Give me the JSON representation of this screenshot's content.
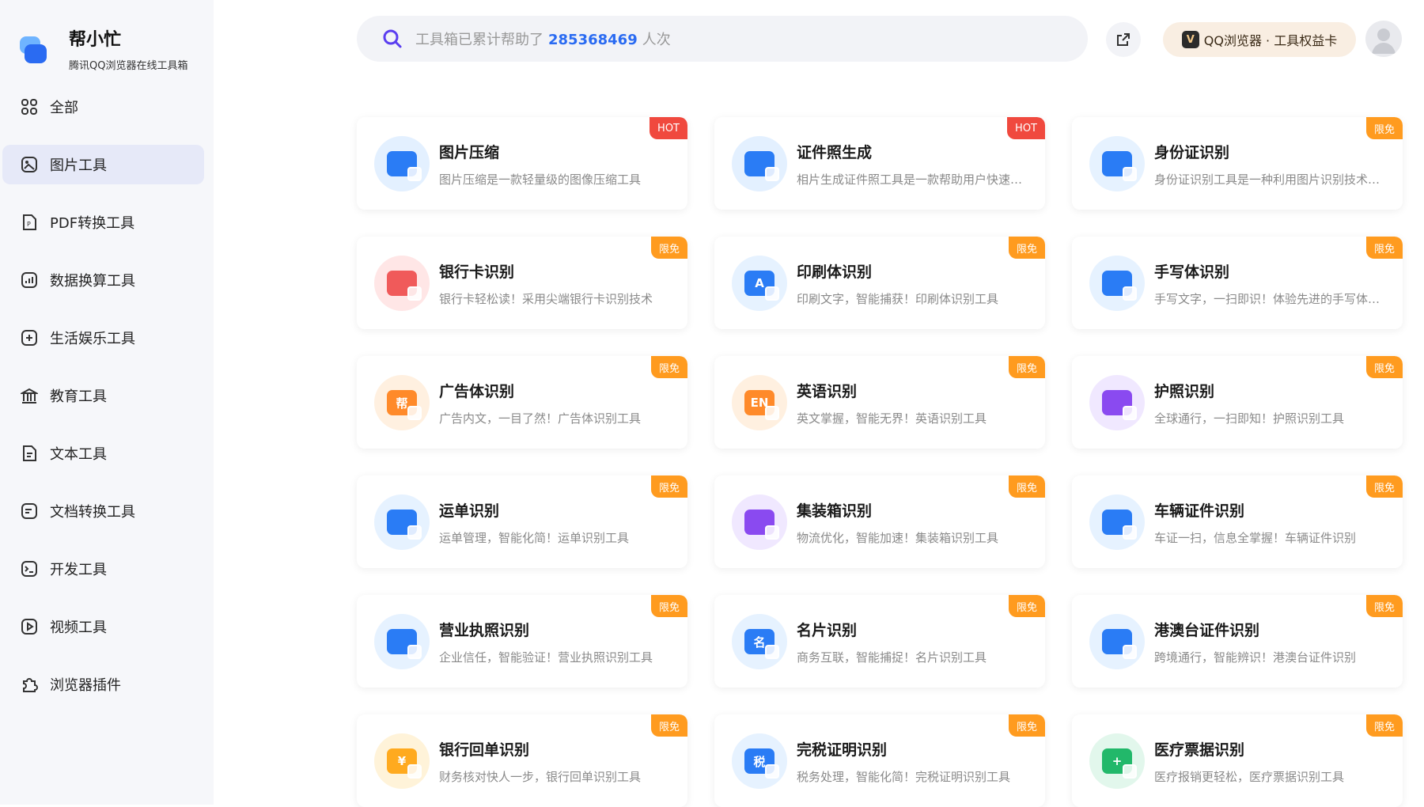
{
  "brand": {
    "title": "帮小忙",
    "subtitle": "腾讯QQ浏览器在线工具箱"
  },
  "nav": [
    {
      "label": "全部",
      "icon": "grid-icon"
    },
    {
      "label": "图片工具",
      "icon": "image-icon",
      "active": true
    },
    {
      "label": "PDF转换工具",
      "icon": "pdf-icon"
    },
    {
      "label": "数据换算工具",
      "icon": "chart-icon"
    },
    {
      "label": "生活娱乐工具",
      "icon": "game-icon"
    },
    {
      "label": "教育工具",
      "icon": "school-icon"
    },
    {
      "label": "文本工具",
      "icon": "text-file-icon"
    },
    {
      "label": "文档转换工具",
      "icon": "doc-convert-icon"
    },
    {
      "label": "开发工具",
      "icon": "terminal-icon"
    },
    {
      "label": "视频工具",
      "icon": "video-icon"
    },
    {
      "label": "浏览器插件",
      "icon": "puzzle-icon"
    }
  ],
  "search": {
    "prefix": "工具箱已累计帮助了",
    "count": "285368469",
    "suffix": "人次"
  },
  "vip": {
    "label": "QQ浏览器 · 工具权益卡",
    "icon_text": "V"
  },
  "cards": [
    {
      "title": "图片压缩",
      "desc": "图片压缩是一款轻量级的图像压缩工具",
      "badge": "HOT",
      "badge_type": "hot",
      "icon": "image-compress-icon",
      "bg": "#e3f0ff",
      "color": "#2a7cf5",
      "glyph": ""
    },
    {
      "title": "证件照生成",
      "desc": "相片生成证件照工具是一款帮助用户快速生成证件照的工具",
      "badge": "HOT",
      "badge_type": "hot",
      "icon": "id-photo-icon",
      "bg": "#e3f0ff",
      "color": "#2a7cf5",
      "glyph": ""
    },
    {
      "title": "身份证识别",
      "desc": "身份证识别工具是一种利用图片识别技术的工具",
      "badge": "限免",
      "badge_type": "free",
      "icon": "id-card-icon",
      "bg": "#e6f2ff",
      "color": "#2a7cf5",
      "glyph": ""
    },
    {
      "title": "银行卡识别",
      "desc": "银行卡轻松读！采用尖端银行卡识别技术",
      "badge": "限免",
      "badge_type": "free",
      "icon": "bank-card-icon",
      "bg": "#ffe6e6",
      "color": "#f05a5a",
      "glyph": ""
    },
    {
      "title": "印刷体识别",
      "desc": "印刷文字，智能捕获！印刷体识别工具",
      "badge": "限免",
      "badge_type": "free",
      "icon": "print-text-icon",
      "bg": "#e6f2ff",
      "color": "#2a7cf5",
      "glyph": "A"
    },
    {
      "title": "手写体识别",
      "desc": "手写文字，一扫即识！体验先进的手写体识别",
      "badge": "限免",
      "badge_type": "free",
      "icon": "handwriting-icon",
      "bg": "#e6f2ff",
      "color": "#2a7cf5",
      "glyph": ""
    },
    {
      "title": "广告体识别",
      "desc": "广告内文，一目了然！广告体识别工具",
      "badge": "限免",
      "badge_type": "free",
      "icon": "ad-text-icon",
      "bg": "#fff0e0",
      "color": "#ff8a2a",
      "glyph": "帮"
    },
    {
      "title": "英语识别",
      "desc": "英文掌握，智能无界！英语识别工具",
      "badge": "限免",
      "badge_type": "free",
      "icon": "english-icon",
      "bg": "#fff0e0",
      "color": "#ff8a2a",
      "glyph": "EN"
    },
    {
      "title": "护照识别",
      "desc": "全球通行，一扫即知！护照识别工具",
      "badge": "限免",
      "badge_type": "free",
      "icon": "passport-icon",
      "bg": "#f0e8ff",
      "color": "#8a4af0",
      "glyph": ""
    },
    {
      "title": "运单识别",
      "desc": "运单管理，智能化简！运单识别工具",
      "badge": "限免",
      "badge_type": "free",
      "icon": "waybill-icon",
      "bg": "#e6f2ff",
      "color": "#2a7cf5",
      "glyph": ""
    },
    {
      "title": "集装箱识别",
      "desc": "物流优化，智能加速！集装箱识别工具",
      "badge": "限免",
      "badge_type": "free",
      "icon": "container-icon",
      "bg": "#f0e8ff",
      "color": "#8a4af0",
      "glyph": ""
    },
    {
      "title": "车辆证件识别",
      "desc": "车证一扫，信息全掌握！车辆证件识别",
      "badge": "限免",
      "badge_type": "free",
      "icon": "vehicle-doc-icon",
      "bg": "#e6f2ff",
      "color": "#2a7cf5",
      "glyph": ""
    },
    {
      "title": "营业执照识别",
      "desc": "企业信任，智能验证！营业执照识别工具",
      "badge": "限免",
      "badge_type": "free",
      "icon": "business-license-icon",
      "bg": "#e6f2ff",
      "color": "#2a7cf5",
      "glyph": ""
    },
    {
      "title": "名片识别",
      "desc": "商务互联，智能捕捉！名片识别工具",
      "badge": "限免",
      "badge_type": "free",
      "icon": "business-card-icon",
      "bg": "#e6f2ff",
      "color": "#2a7cf5",
      "glyph": "名"
    },
    {
      "title": "港澳台证件识别",
      "desc": "跨境通行，智能辨识！港澳台证件识别",
      "badge": "限免",
      "badge_type": "free",
      "icon": "hk-pass-icon",
      "bg": "#e6f2ff",
      "color": "#2a7cf5",
      "glyph": ""
    },
    {
      "title": "银行回单识别",
      "desc": "财务核对快人一步，银行回单识别工具",
      "badge": "限免",
      "badge_type": "free",
      "icon": "bank-receipt-icon",
      "bg": "#fff3d9",
      "color": "#ffaa1f",
      "glyph": "¥"
    },
    {
      "title": "完税证明识别",
      "desc": "税务处理，智能化简！完税证明识别工具",
      "badge": "限免",
      "badge_type": "free",
      "icon": "tax-cert-icon",
      "bg": "#e6f2ff",
      "color": "#2a7cf5",
      "glyph": "税"
    },
    {
      "title": "医疗票据识别",
      "desc": "医疗报销更轻松，医疗票据识别工具",
      "badge": "限免",
      "badge_type": "free",
      "icon": "medical-bill-icon",
      "bg": "#e2f7ec",
      "color": "#22b86a",
      "glyph": "+"
    }
  ]
}
